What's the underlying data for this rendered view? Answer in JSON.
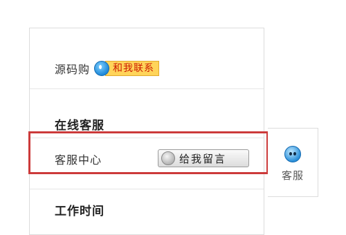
{
  "source": {
    "label": "源码购",
    "qq_icon": "qq-icon",
    "contact_label": "和我联系"
  },
  "online_service": {
    "heading": "在线客服"
  },
  "service_center": {
    "label": "客服中心",
    "leave_icon": "qq-offline-icon",
    "leave_message_label": "给我留言"
  },
  "work_hours": {
    "heading": "工作时间"
  },
  "side_tab": {
    "icon": "qq-penguin-icon",
    "label": "客服"
  },
  "colors": {
    "highlight_border": "#cc3a3a",
    "contact_bg": "#ffd45a",
    "contact_text": "#cc1b00"
  }
}
